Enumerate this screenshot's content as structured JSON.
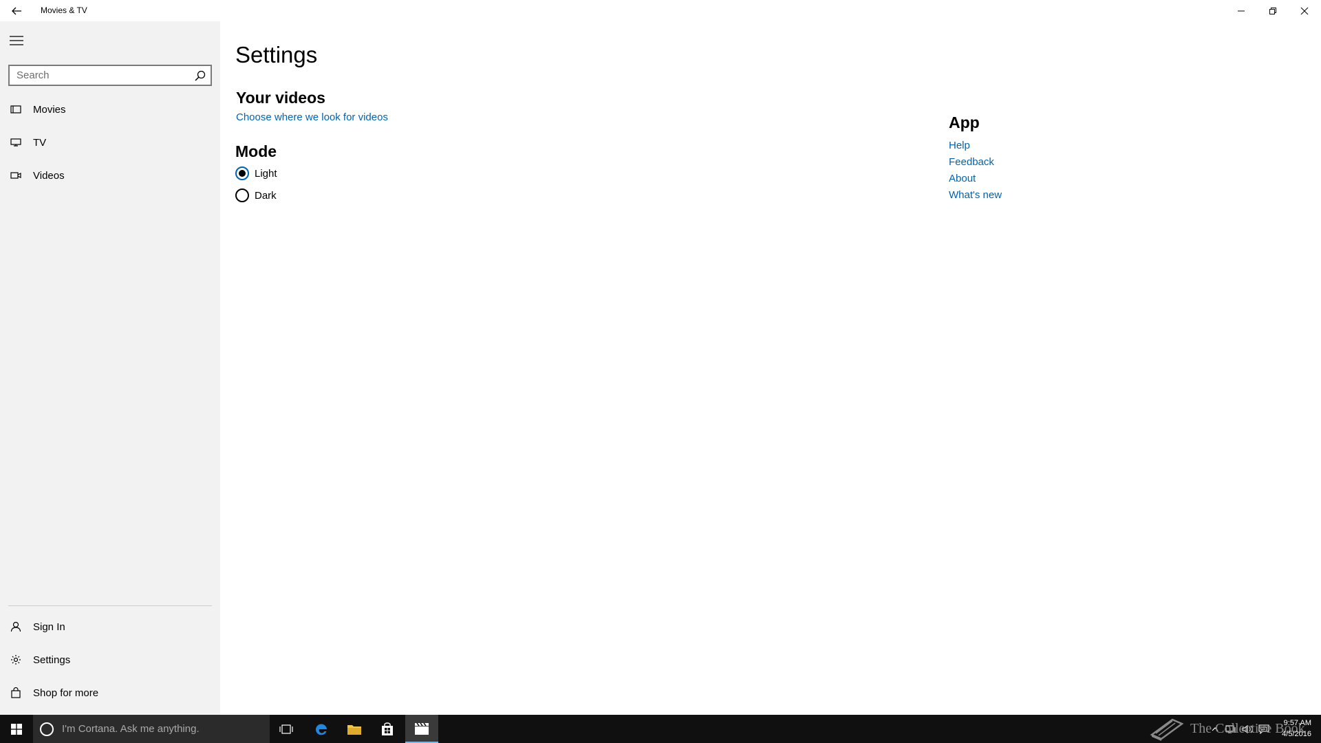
{
  "window": {
    "title": "Movies & TV"
  },
  "sidebar": {
    "search_placeholder": "Search",
    "items": [
      {
        "label": "Movies",
        "icon": "film-icon"
      },
      {
        "label": "TV",
        "icon": "tv-icon"
      },
      {
        "label": "Videos",
        "icon": "video-camera-icon"
      }
    ],
    "bottom_items": [
      {
        "label": "Sign In",
        "icon": "person-icon"
      },
      {
        "label": "Settings",
        "icon": "gear-icon"
      },
      {
        "label": "Shop for more",
        "icon": "shopping-bag-icon"
      }
    ]
  },
  "main": {
    "title": "Settings",
    "your_videos": {
      "heading": "Your videos",
      "link": "Choose where we look for videos"
    },
    "mode": {
      "heading": "Mode",
      "options": [
        "Light",
        "Dark"
      ],
      "selected": "Light"
    },
    "app": {
      "heading": "App",
      "links": [
        "Help",
        "Feedback",
        "About",
        "What's new"
      ]
    }
  },
  "taskbar": {
    "cortana_placeholder": "I'm Cortana. Ask me anything.",
    "time": "9:57 AM",
    "date": "4/5/2016"
  },
  "watermark": {
    "text": "The Collective Book"
  },
  "colors": {
    "accent": "#0063b1",
    "sidebar_bg": "#f2f2f2",
    "taskbar_bg": "#101010"
  }
}
